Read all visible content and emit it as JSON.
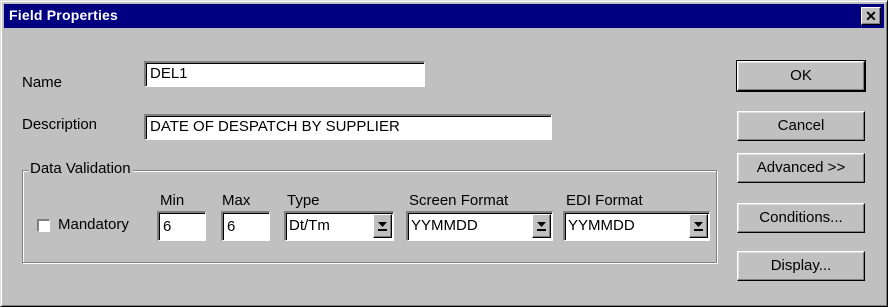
{
  "window": {
    "title": "Field Properties",
    "close_glyph": "✕"
  },
  "fields": {
    "name_label": "Name",
    "name_value": "DEL1",
    "description_label": "Description",
    "description_value": "DATE OF DESPATCH BY SUPPLIER"
  },
  "validation": {
    "group_title": "Data Validation",
    "mandatory_label": "Mandatory",
    "mandatory_checked": false,
    "min_label": "Min",
    "min_value": "6",
    "max_label": "Max",
    "max_value": "6",
    "type_label": "Type",
    "type_value": "Dt/Tm",
    "screen_format_label": "Screen Format",
    "screen_format_value": "YYMMDD",
    "edi_format_label": "EDI Format",
    "edi_format_value": "YYMMDD"
  },
  "buttons": {
    "ok": "OK",
    "cancel": "Cancel",
    "advanced": "Advanced >>",
    "conditions": "Conditions...",
    "display": "Display..."
  },
  "colors": {
    "titlebar": "#000080",
    "face": "#c0c0c0"
  }
}
